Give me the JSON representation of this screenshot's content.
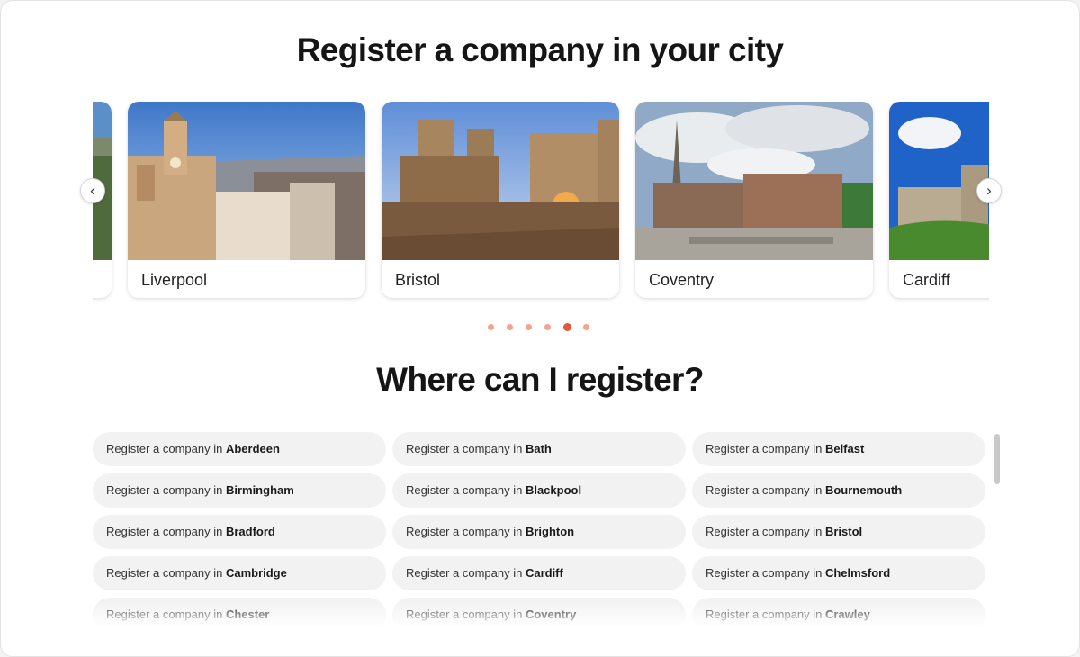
{
  "carousel": {
    "title": "Register a company in your city",
    "cards": [
      {
        "name": "",
        "visible": "partial-left"
      },
      {
        "name": "Liverpool"
      },
      {
        "name": "Bristol"
      },
      {
        "name": "Coventry"
      },
      {
        "name": "Cardiff",
        "visible": "partial-right"
      }
    ],
    "prev_icon": "chevron-left-icon",
    "next_icon": "chevron-right-icon",
    "dots_count": 6,
    "active_dot": 5
  },
  "register_section": {
    "title": "Where can I register?",
    "prefix": "Register a company in ",
    "cities": [
      "Aberdeen",
      "Bath",
      "Belfast",
      "Birmingham",
      "Blackpool",
      "Bournemouth",
      "Bradford",
      "Brighton",
      "Bristol",
      "Cambridge",
      "Cardiff",
      "Chelmsford",
      "Chester",
      "Coventry",
      "Crawley"
    ]
  },
  "colors": {
    "accent": "#e5553a",
    "dot_inactive": "#f3a48b",
    "pill_bg": "#f2f2f2"
  }
}
